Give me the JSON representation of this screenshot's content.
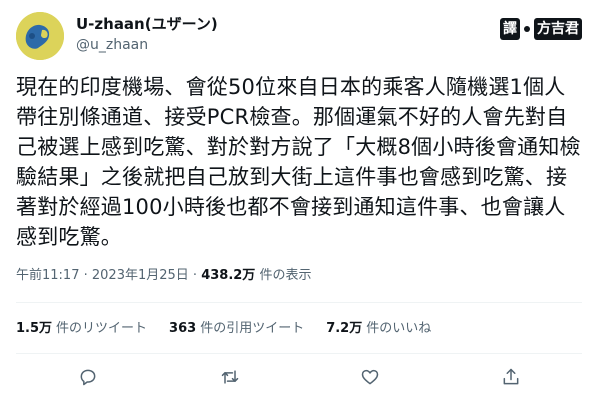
{
  "author": {
    "display_name": "U-zhaan(ユザーン)",
    "handle": "@u_zhaan"
  },
  "translate_badge": {
    "left_char": "譯",
    "right_text": "方吉君"
  },
  "tweet": {
    "text": "現在的印度機場、會從50位來自日本的乘客人隨機選1個人帶往別條通道、接受PCR檢查。那個運氣不好的人會先對自己被選上感到吃驚、對於對方說了「大概8個小時後會通知檢驗結果」之後就把自己放到大街上這件事也會感到吃驚、接著對於經過100小時後也都不會接到通知這件事、也會讓人感到吃驚。"
  },
  "meta": {
    "time": "午前11:17",
    "sep1": " · ",
    "date": "2023年1月25日",
    "sep2": " · ",
    "views_count": "438.2万",
    "views_label": " 件の表示"
  },
  "stats": {
    "retweets_count": "1.5万",
    "retweets_label": "件のリツイート",
    "quotes_count": "363",
    "quotes_label": "件の引用ツイート",
    "likes_count": "7.2万",
    "likes_label": "件のいいね"
  },
  "icons": {
    "reply": "reply-icon",
    "retweet": "retweet-icon",
    "like": "like-icon",
    "share": "share-icon"
  },
  "colors": {
    "text": "#0f1419",
    "secondary": "#536471",
    "divider": "#eff3f4"
  }
}
